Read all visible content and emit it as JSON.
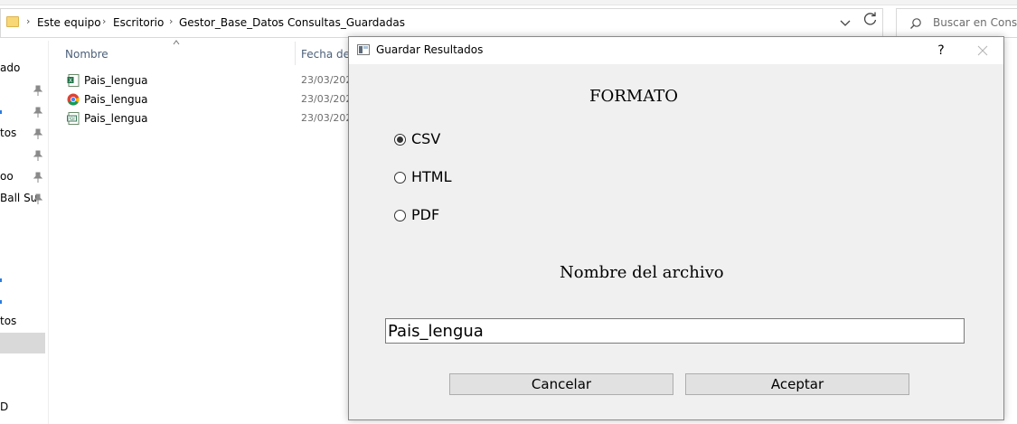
{
  "explorer": {
    "breadcrumb": [
      "Este equipo",
      "Escritorio",
      "Gestor_Base_Datos",
      "Consultas_Guardadas"
    ],
    "search_placeholder": "Buscar en Consult",
    "nav_items": [
      "ado",
      "tos",
      "oo",
      "Ball Su",
      "tos",
      "D"
    ],
    "columns": {
      "name": "Nombre",
      "date": "Fecha de m"
    },
    "files": [
      {
        "name": "Pais_lengua",
        "date": "23/03/202",
        "icon": "csv-file-icon"
      },
      {
        "name": "Pais_lengua",
        "date": "23/03/202",
        "icon": "chrome-html-icon"
      },
      {
        "name": "Pais_lengua",
        "date": "23/03/202",
        "icon": "pdf-file-icon"
      }
    ]
  },
  "dialog": {
    "title": "Guardar Resultados",
    "help": "?",
    "format_heading": "FORMATO",
    "options": [
      {
        "label": "CSV",
        "checked": true
      },
      {
        "label": "HTML",
        "checked": false
      },
      {
        "label": "PDF",
        "checked": false
      }
    ],
    "filename_heading": "Nombre del archivo",
    "filename_value": "Pais_lengua",
    "cancel_label": "Cancelar",
    "accept_label": "Aceptar"
  }
}
